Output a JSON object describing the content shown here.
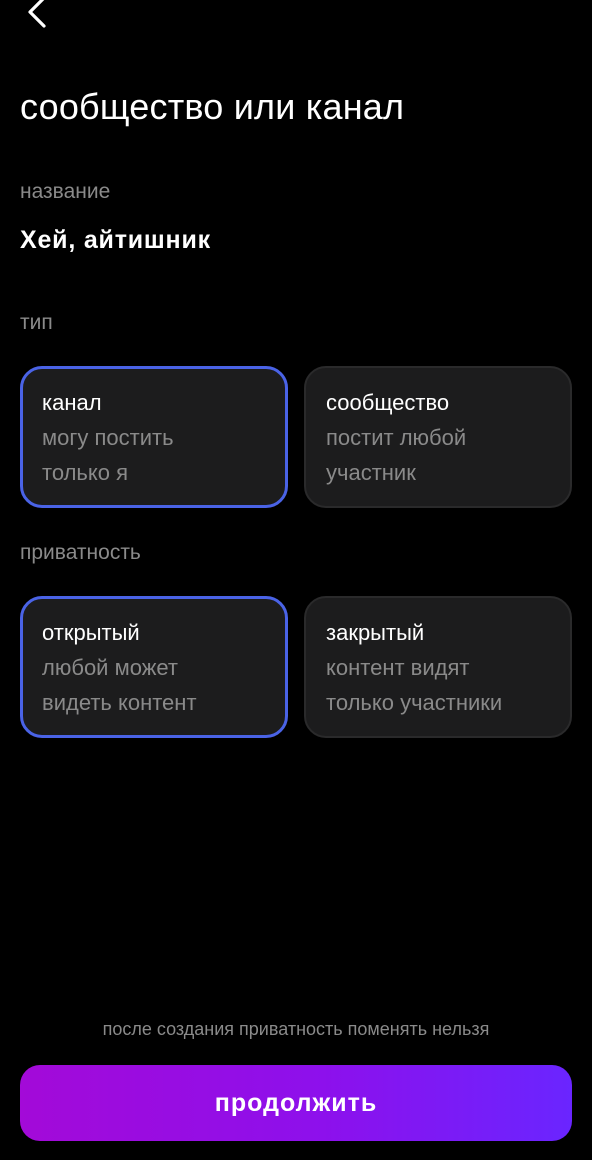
{
  "header": {
    "back_icon": "chevron-left-icon",
    "title": "сообщество или канал"
  },
  "name_section": {
    "label": "название",
    "value": "Хей, айтишник"
  },
  "type_section": {
    "label": "тип",
    "options": [
      {
        "title": "канал",
        "description": "могу постить только я",
        "selected": true
      },
      {
        "title": "сообщество",
        "description": "постит любой участник",
        "selected": false
      }
    ]
  },
  "privacy_section": {
    "label": "приватность",
    "options": [
      {
        "title": "открытый",
        "description": "любой может видеть контент",
        "selected": true
      },
      {
        "title": "закрытый",
        "description": "контент видят только участники",
        "selected": false
      }
    ]
  },
  "footer": {
    "note": "после создания приватность поменять нельзя",
    "continue_label": "продолжить"
  },
  "colors": {
    "background": "#000000",
    "card_bg": "#1c1c1d",
    "selected_border": "#4a63e6",
    "muted_text": "#8a8a8a",
    "button_gradient_start": "#a30ad8",
    "button_gradient_end": "#6a25ff"
  }
}
